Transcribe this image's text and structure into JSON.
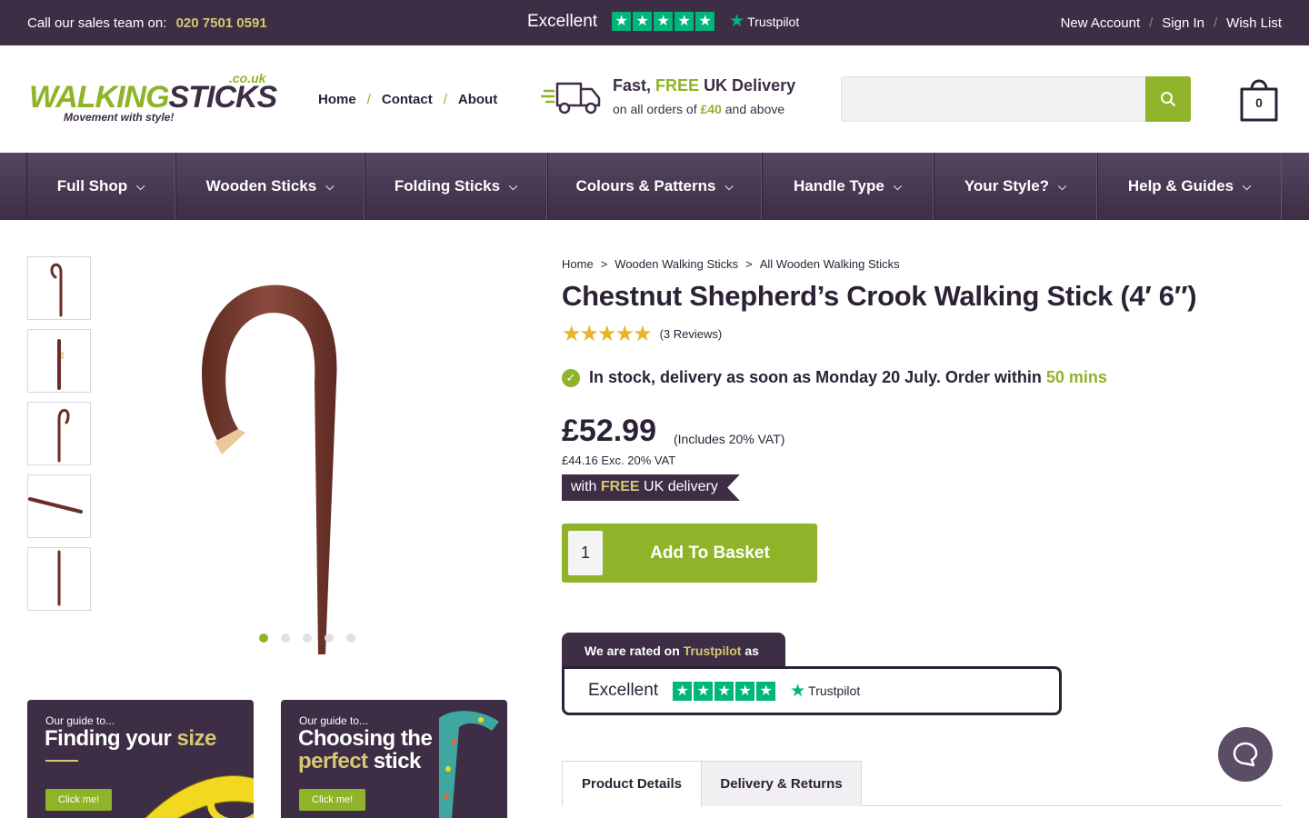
{
  "topbar": {
    "sales_label": "Call our sales team on:",
    "phone": "020 7501 0591",
    "trustpilot_rating": "Excellent",
    "trustpilot_brand": "Trustpilot",
    "links": [
      "New Account",
      "Sign In",
      "Wish List"
    ]
  },
  "header": {
    "logo_part1": "WALKING",
    "logo_part2": "STICKS",
    "logo_suffix": ".co.uk",
    "logo_tagline": "Movement with style!",
    "nav": [
      "Home",
      "Contact",
      "About"
    ],
    "delivery_fast": "Fast,",
    "delivery_free": "FREE",
    "delivery_uk": "UK Delivery",
    "delivery_line2_pre": "on all orders of",
    "delivery_amount": "£40",
    "delivery_line2_post": "and above",
    "search_placeholder": "",
    "basket_count": "0"
  },
  "categories": [
    "Full Shop",
    "Wooden Sticks",
    "Folding Sticks",
    "Colours & Patterns",
    "Handle Type",
    "Your Style?",
    "Help & Guides"
  ],
  "gallery": {
    "thumbnail_count": 5,
    "active_dot": 0
  },
  "guides": [
    {
      "small": "Our guide to...",
      "big1": "Finding your",
      "big_hl": "size",
      "big2": "",
      "cta": "Click me!"
    },
    {
      "small": "Our guide to...",
      "big1": "Choosing the",
      "big_hl": "perfect",
      "big2": "stick",
      "cta": "Click me!"
    }
  ],
  "product": {
    "breadcrumbs": [
      "Home",
      "Wooden Walking Sticks",
      "All Wooden Walking Sticks"
    ],
    "breadcrumb_sep": ">",
    "title": "Chestnut Shepherd’s Crook Walking Stick (4′ 6″)",
    "rating_stars": 5,
    "reviews": "(3 Reviews)",
    "stock_text": "In stock, delivery as soon as Monday 20 July. Order within",
    "stock_mins": "50 mins",
    "price": "£52.99",
    "vat_note": "(Includes 20% VAT)",
    "ex_vat": "£44.16 Exc. 20% VAT",
    "badge_pre": "with",
    "badge_free": "FREE",
    "badge_post": "UK delivery",
    "quantity": "1",
    "add_to_basket": "Add To Basket"
  },
  "trustpilot_widget": {
    "rated_pre": "We are rated on",
    "rated_brand": "Trustpilot",
    "rated_post": "as",
    "rating": "Excellent",
    "brand": "Trustpilot"
  },
  "tabs": [
    "Product Details",
    "Delivery & Returns"
  ],
  "colors": {
    "purple": "#3d2e46",
    "green": "#8fb329",
    "gold": "#d6c772",
    "trustpilot": "#00b67a",
    "star": "#e7b52a"
  }
}
